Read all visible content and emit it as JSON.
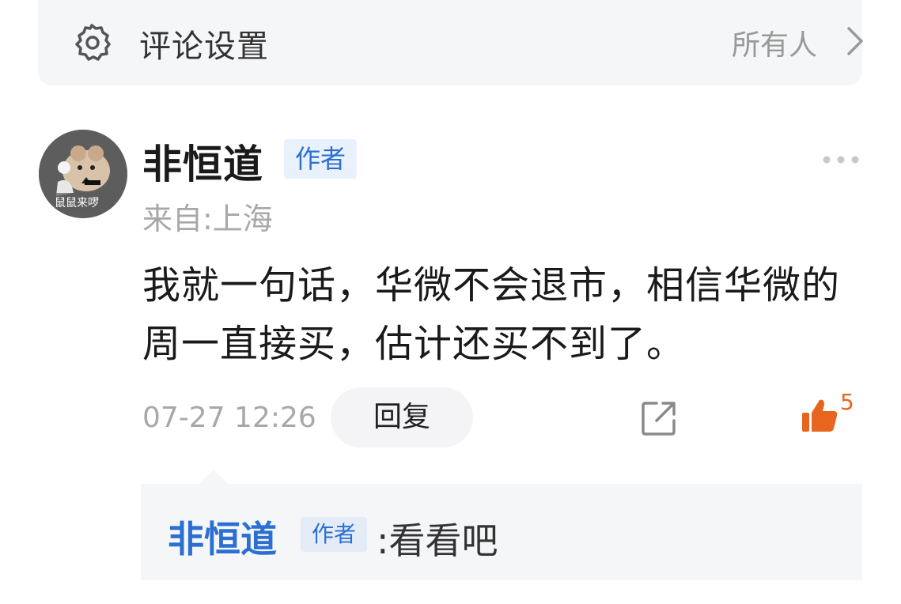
{
  "settings": {
    "icon": "gear-icon",
    "title": "评论设置",
    "value": "所有人",
    "chevron": "chevron-right-icon"
  },
  "comment": {
    "avatar_caption": "鼠鼠来啰",
    "author": "非恒道",
    "badge": "作者",
    "location": "来自:上海",
    "text": "我就一句话，华微不会退市，相信华微的周一直接买，估计还买不到了。",
    "timestamp": "07-27 12:26",
    "reply_label": "回复",
    "like_count": "5",
    "colors": {
      "like": "#e8651f",
      "author_blue": "#2b6fd1"
    }
  },
  "reply": {
    "author": "非恒道",
    "badge": "作者",
    "content": ":看看吧"
  }
}
